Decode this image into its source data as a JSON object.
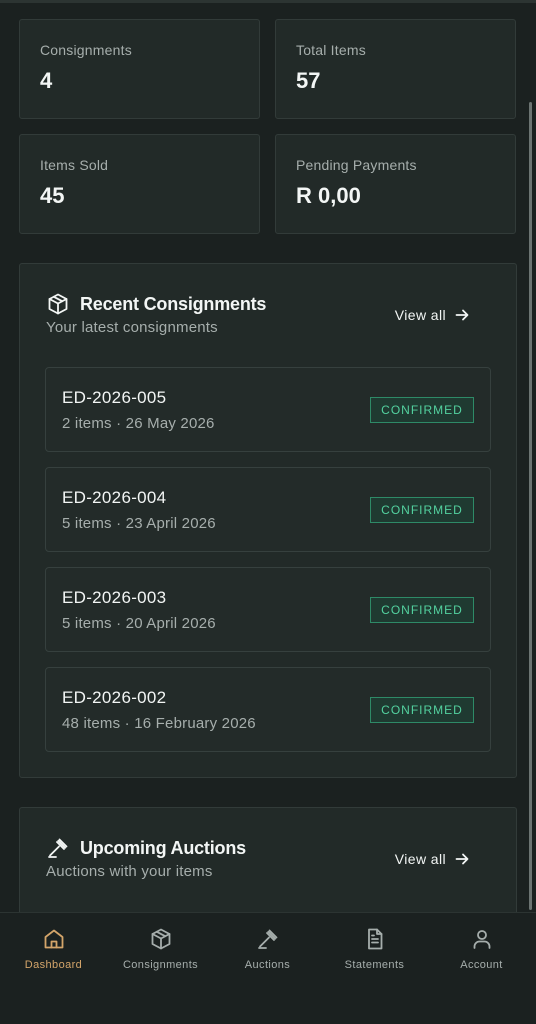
{
  "stats": [
    {
      "label": "Consignments",
      "value": "4"
    },
    {
      "label": "Total Items",
      "value": "57"
    },
    {
      "label": "Items Sold",
      "value": "45"
    },
    {
      "label": "Pending Payments",
      "value": "R 0,00"
    }
  ],
  "recent": {
    "title": "Recent Consignments",
    "subtitle": "Your latest consignments",
    "view_all": "View all",
    "icon": "package-icon",
    "items": [
      {
        "id": "ED-2026-005",
        "meta": "2 items · 26 May 2026",
        "status": "CONFIRMED"
      },
      {
        "id": "ED-2026-004",
        "meta": "5 items · 23 April 2026",
        "status": "CONFIRMED"
      },
      {
        "id": "ED-2026-003",
        "meta": "5 items · 20 April 2026",
        "status": "CONFIRMED"
      },
      {
        "id": "ED-2026-002",
        "meta": "48 items · 16 February 2026",
        "status": "CONFIRMED"
      }
    ]
  },
  "auctions": {
    "title": "Upcoming Auctions",
    "subtitle": "Auctions with your items",
    "view_all": "View all",
    "icon": "gavel-icon"
  },
  "nav": [
    {
      "label": "Dashboard",
      "icon": "home-icon",
      "active": true
    },
    {
      "label": "Consignments",
      "icon": "package-icon",
      "active": false
    },
    {
      "label": "Auctions",
      "icon": "gavel-icon",
      "active": false
    },
    {
      "label": "Statements",
      "icon": "document-icon",
      "active": false
    },
    {
      "label": "Account",
      "icon": "user-icon",
      "active": false
    }
  ],
  "colors": {
    "background": "#1b2120",
    "card": "#222a28",
    "accent_active": "#d4a56a",
    "badge_green": "#53d19f"
  }
}
